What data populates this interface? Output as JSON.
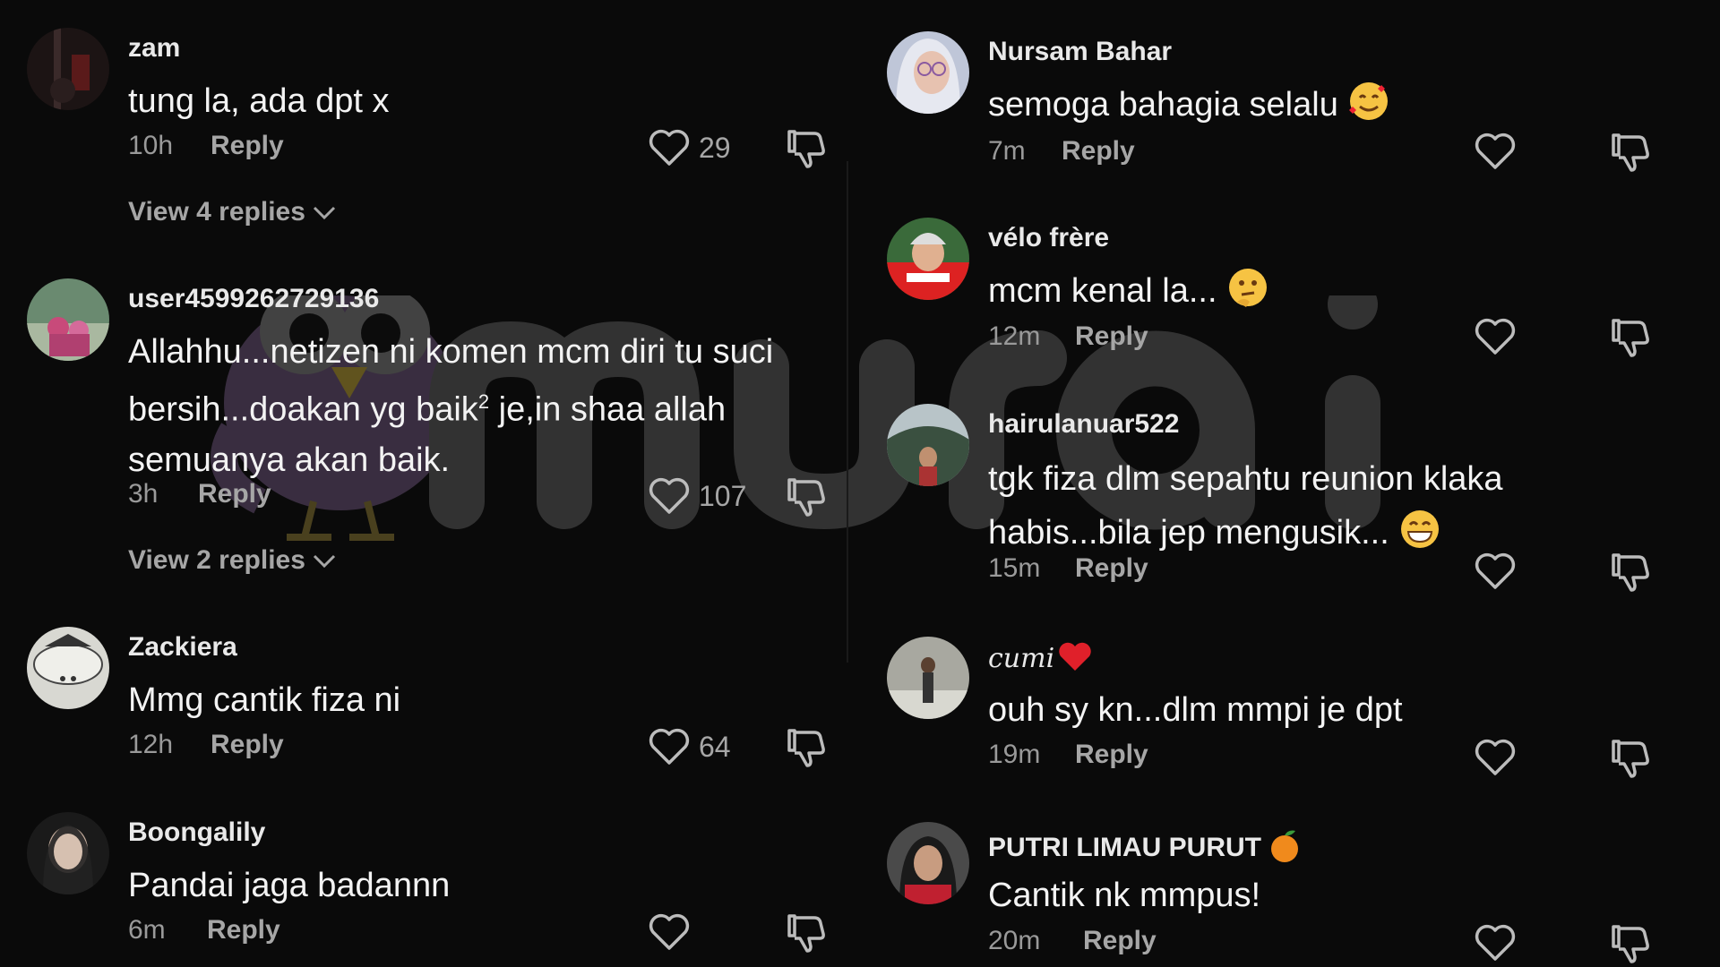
{
  "watermark": {
    "text": "murai"
  },
  "left_comments": [
    {
      "author": "zam",
      "text": "tung la, ada dpt x",
      "time": "10h",
      "reply_label": "Reply",
      "likes": "29",
      "view_replies": "View 4 replies"
    },
    {
      "author": "user4599262729136",
      "text_line1": "Allahhu...netizen ni komen mcm diri tu suci",
      "text_line2a": "bersih...doakan yg baik",
      "text_sup": "2",
      "text_line2b": " je,in shaa allah",
      "text_line3": "semuanya akan baik.",
      "time": "3h",
      "reply_label": "Reply",
      "likes": "107",
      "view_replies": "View 2 replies"
    },
    {
      "author": "Zackiera",
      "text": "Mmg cantik fiza ni",
      "time": "12h",
      "reply_label": "Reply",
      "likes": "64"
    },
    {
      "author": "Boongalily",
      "text": "Pandai jaga badannn",
      "time": "6m",
      "reply_label": "Reply",
      "likes": ""
    }
  ],
  "right_comments": [
    {
      "author": "Nursam Bahar",
      "text": "semoga bahagia selalu",
      "emoji": "smiling-face-with-hearts",
      "time": "7m",
      "reply_label": "Reply"
    },
    {
      "author": "vélo frère",
      "text": "mcm kenal la...",
      "emoji": "thinking-face",
      "time": "12m",
      "reply_label": "Reply"
    },
    {
      "author": "hairulanuar522",
      "text_line1": "tgk fiza dlm sepahtu reunion klaka",
      "text_line2": "habis...bila jep mengusik...",
      "emoji": "grinning-face",
      "time": "15m",
      "reply_label": "Reply"
    },
    {
      "author": "cumi",
      "author_emoji": "red-heart",
      "text": "ouh sy kn...dlm mmpi je dpt",
      "time": "19m",
      "reply_label": "Reply"
    },
    {
      "author": "PUTRI LIMAU PURUT",
      "author_emoji": "tangerine",
      "text": "Cantik nk mmpus!",
      "time": "20m",
      "reply_label": "Reply"
    }
  ],
  "icons": {
    "like": "heart-outline-icon",
    "dislike": "thumbs-down-outline-icon",
    "expand": "chevron-down-icon"
  },
  "colors": {
    "background": "#0a0a0a",
    "text": "#f3f3f3",
    "muted": "#9a9a9a",
    "watermark": "#6b5a78"
  }
}
